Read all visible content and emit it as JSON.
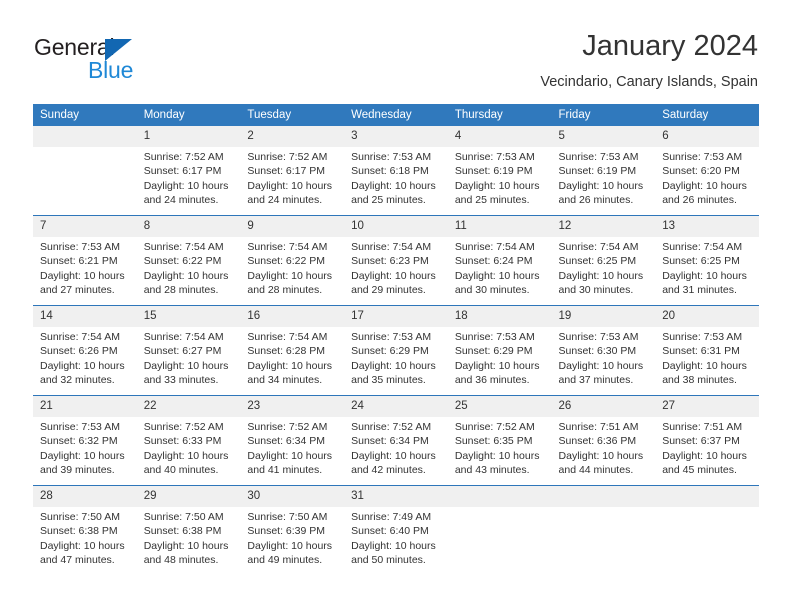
{
  "brand": {
    "name_part1": "General",
    "name_part2": "Blue",
    "logo_icon": "triangle-icon"
  },
  "header": {
    "month_title": "January 2024",
    "location": "Vecindario, Canary Islands, Spain"
  },
  "calendar": {
    "weekday_headers": [
      "Sunday",
      "Monday",
      "Tuesday",
      "Wednesday",
      "Thursday",
      "Friday",
      "Saturday"
    ],
    "colors": {
      "header_bg": "#3079bd",
      "header_text": "#ffffff",
      "daynum_bg": "#f0f0f0",
      "week_divider": "#2e76ba",
      "brand_dark": "#231f20",
      "brand_blue": "#1f88d6",
      "body_text": "#333333"
    },
    "weeks": [
      [
        {
          "empty": true
        },
        {
          "day": "1",
          "sunrise": "Sunrise: 7:52 AM",
          "sunset": "Sunset: 6:17 PM",
          "daylight1": "Daylight: 10 hours",
          "daylight2": "and 24 minutes."
        },
        {
          "day": "2",
          "sunrise": "Sunrise: 7:52 AM",
          "sunset": "Sunset: 6:17 PM",
          "daylight1": "Daylight: 10 hours",
          "daylight2": "and 24 minutes."
        },
        {
          "day": "3",
          "sunrise": "Sunrise: 7:53 AM",
          "sunset": "Sunset: 6:18 PM",
          "daylight1": "Daylight: 10 hours",
          "daylight2": "and 25 minutes."
        },
        {
          "day": "4",
          "sunrise": "Sunrise: 7:53 AM",
          "sunset": "Sunset: 6:19 PM",
          "daylight1": "Daylight: 10 hours",
          "daylight2": "and 25 minutes."
        },
        {
          "day": "5",
          "sunrise": "Sunrise: 7:53 AM",
          "sunset": "Sunset: 6:19 PM",
          "daylight1": "Daylight: 10 hours",
          "daylight2": "and 26 minutes."
        },
        {
          "day": "6",
          "sunrise": "Sunrise: 7:53 AM",
          "sunset": "Sunset: 6:20 PM",
          "daylight1": "Daylight: 10 hours",
          "daylight2": "and 26 minutes."
        }
      ],
      [
        {
          "day": "7",
          "sunrise": "Sunrise: 7:53 AM",
          "sunset": "Sunset: 6:21 PM",
          "daylight1": "Daylight: 10 hours",
          "daylight2": "and 27 minutes."
        },
        {
          "day": "8",
          "sunrise": "Sunrise: 7:54 AM",
          "sunset": "Sunset: 6:22 PM",
          "daylight1": "Daylight: 10 hours",
          "daylight2": "and 28 minutes."
        },
        {
          "day": "9",
          "sunrise": "Sunrise: 7:54 AM",
          "sunset": "Sunset: 6:22 PM",
          "daylight1": "Daylight: 10 hours",
          "daylight2": "and 28 minutes."
        },
        {
          "day": "10",
          "sunrise": "Sunrise: 7:54 AM",
          "sunset": "Sunset: 6:23 PM",
          "daylight1": "Daylight: 10 hours",
          "daylight2": "and 29 minutes."
        },
        {
          "day": "11",
          "sunrise": "Sunrise: 7:54 AM",
          "sunset": "Sunset: 6:24 PM",
          "daylight1": "Daylight: 10 hours",
          "daylight2": "and 30 minutes."
        },
        {
          "day": "12",
          "sunrise": "Sunrise: 7:54 AM",
          "sunset": "Sunset: 6:25 PM",
          "daylight1": "Daylight: 10 hours",
          "daylight2": "and 30 minutes."
        },
        {
          "day": "13",
          "sunrise": "Sunrise: 7:54 AM",
          "sunset": "Sunset: 6:25 PM",
          "daylight1": "Daylight: 10 hours",
          "daylight2": "and 31 minutes."
        }
      ],
      [
        {
          "day": "14",
          "sunrise": "Sunrise: 7:54 AM",
          "sunset": "Sunset: 6:26 PM",
          "daylight1": "Daylight: 10 hours",
          "daylight2": "and 32 minutes."
        },
        {
          "day": "15",
          "sunrise": "Sunrise: 7:54 AM",
          "sunset": "Sunset: 6:27 PM",
          "daylight1": "Daylight: 10 hours",
          "daylight2": "and 33 minutes."
        },
        {
          "day": "16",
          "sunrise": "Sunrise: 7:54 AM",
          "sunset": "Sunset: 6:28 PM",
          "daylight1": "Daylight: 10 hours",
          "daylight2": "and 34 minutes."
        },
        {
          "day": "17",
          "sunrise": "Sunrise: 7:53 AM",
          "sunset": "Sunset: 6:29 PM",
          "daylight1": "Daylight: 10 hours",
          "daylight2": "and 35 minutes."
        },
        {
          "day": "18",
          "sunrise": "Sunrise: 7:53 AM",
          "sunset": "Sunset: 6:29 PM",
          "daylight1": "Daylight: 10 hours",
          "daylight2": "and 36 minutes."
        },
        {
          "day": "19",
          "sunrise": "Sunrise: 7:53 AM",
          "sunset": "Sunset: 6:30 PM",
          "daylight1": "Daylight: 10 hours",
          "daylight2": "and 37 minutes."
        },
        {
          "day": "20",
          "sunrise": "Sunrise: 7:53 AM",
          "sunset": "Sunset: 6:31 PM",
          "daylight1": "Daylight: 10 hours",
          "daylight2": "and 38 minutes."
        }
      ],
      [
        {
          "day": "21",
          "sunrise": "Sunrise: 7:53 AM",
          "sunset": "Sunset: 6:32 PM",
          "daylight1": "Daylight: 10 hours",
          "daylight2": "and 39 minutes."
        },
        {
          "day": "22",
          "sunrise": "Sunrise: 7:52 AM",
          "sunset": "Sunset: 6:33 PM",
          "daylight1": "Daylight: 10 hours",
          "daylight2": "and 40 minutes."
        },
        {
          "day": "23",
          "sunrise": "Sunrise: 7:52 AM",
          "sunset": "Sunset: 6:34 PM",
          "daylight1": "Daylight: 10 hours",
          "daylight2": "and 41 minutes."
        },
        {
          "day": "24",
          "sunrise": "Sunrise: 7:52 AM",
          "sunset": "Sunset: 6:34 PM",
          "daylight1": "Daylight: 10 hours",
          "daylight2": "and 42 minutes."
        },
        {
          "day": "25",
          "sunrise": "Sunrise: 7:52 AM",
          "sunset": "Sunset: 6:35 PM",
          "daylight1": "Daylight: 10 hours",
          "daylight2": "and 43 minutes."
        },
        {
          "day": "26",
          "sunrise": "Sunrise: 7:51 AM",
          "sunset": "Sunset: 6:36 PM",
          "daylight1": "Daylight: 10 hours",
          "daylight2": "and 44 minutes."
        },
        {
          "day": "27",
          "sunrise": "Sunrise: 7:51 AM",
          "sunset": "Sunset: 6:37 PM",
          "daylight1": "Daylight: 10 hours",
          "daylight2": "and 45 minutes."
        }
      ],
      [
        {
          "day": "28",
          "sunrise": "Sunrise: 7:50 AM",
          "sunset": "Sunset: 6:38 PM",
          "daylight1": "Daylight: 10 hours",
          "daylight2": "and 47 minutes."
        },
        {
          "day": "29",
          "sunrise": "Sunrise: 7:50 AM",
          "sunset": "Sunset: 6:38 PM",
          "daylight1": "Daylight: 10 hours",
          "daylight2": "and 48 minutes."
        },
        {
          "day": "30",
          "sunrise": "Sunrise: 7:50 AM",
          "sunset": "Sunset: 6:39 PM",
          "daylight1": "Daylight: 10 hours",
          "daylight2": "and 49 minutes."
        },
        {
          "day": "31",
          "sunrise": "Sunrise: 7:49 AM",
          "sunset": "Sunset: 6:40 PM",
          "daylight1": "Daylight: 10 hours",
          "daylight2": "and 50 minutes."
        },
        {
          "empty": true
        },
        {
          "empty": true
        },
        {
          "empty": true
        }
      ]
    ]
  }
}
